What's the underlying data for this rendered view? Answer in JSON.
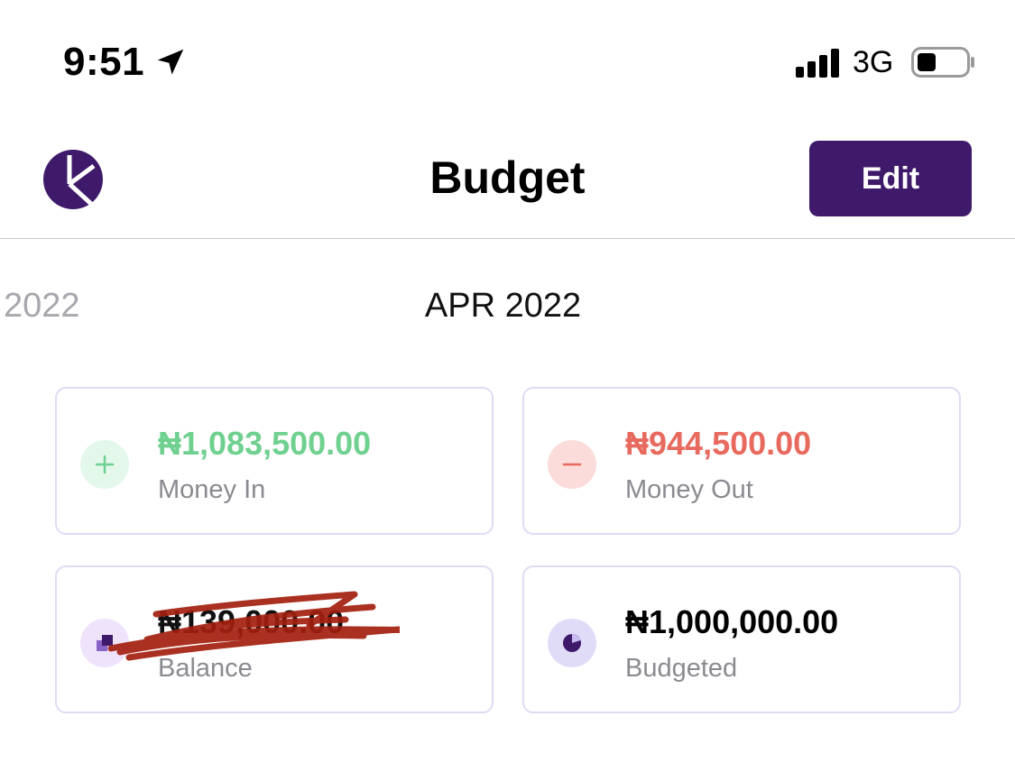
{
  "status_bar": {
    "time": "9:51",
    "network": "3G",
    "icons": [
      "location-arrow-icon",
      "signal-bars-icon",
      "battery-icon"
    ]
  },
  "header": {
    "title": "Budget",
    "edit_label": "Edit",
    "logo": "app-logo-icon"
  },
  "month_selector": {
    "previous": "2022",
    "current": "APR 2022"
  },
  "cards": {
    "money_in": {
      "amount": "₦1,083,500.00",
      "label": "Money In",
      "icon": "plus-icon"
    },
    "money_out": {
      "amount": "₦944,500.00",
      "label": "Money Out",
      "icon": "minus-icon"
    },
    "balance": {
      "amount": "₦139,000.00",
      "label": "Balance",
      "icon": "balance-icon"
    },
    "budgeted": {
      "amount": "₦1,000,000.00",
      "label": "Budgeted",
      "icon": "pie-chart-icon"
    }
  },
  "colors": {
    "brand": "#3f1a6a",
    "money_in": "#6fd08f",
    "money_out": "#e8695d",
    "card_border": "#dcdcf5",
    "redaction": "#a3200f"
  }
}
